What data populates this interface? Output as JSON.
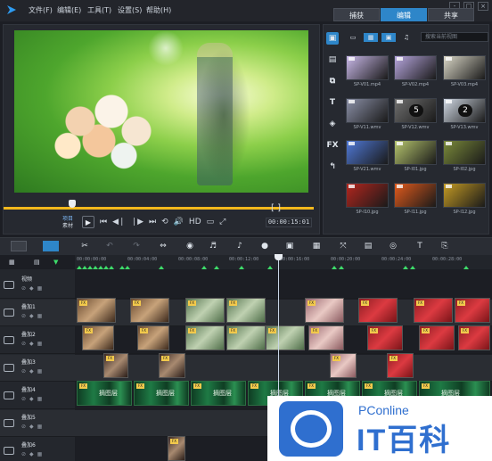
{
  "menubar": {
    "items": [
      "文件(F)",
      "编辑(E)",
      "工具(T)",
      "设置(S)",
      "帮助(H)"
    ],
    "steps": [
      "捕获",
      "编辑",
      "共享"
    ],
    "active_step": "编辑",
    "win_controls": [
      "-",
      "□",
      "×"
    ]
  },
  "preview": {
    "mode_project": "项目",
    "mode_clip": "素材",
    "hd_label": "HD",
    "trim_marks": "[ ]",
    "timecode": "00:00:15:01",
    "scrub_fraction": 0.22
  },
  "library": {
    "search_placeholder": "搜索当前视图",
    "side_labels": [
      "T",
      "FX"
    ],
    "thumbnails": [
      {
        "caption": "SP-V01.mp4",
        "color": "#c9b8e8"
      },
      {
        "caption": "SP-V02.mp4",
        "color": "#b7a6de"
      },
      {
        "caption": "SP-V03.mp4",
        "color": "#d9d6c6"
      },
      {
        "caption": "SP-V11.wmv",
        "color": "#8a8fa6"
      },
      {
        "caption": "SP-V12.wmv",
        "color": "#6f6f6f"
      },
      {
        "caption": "SP-V13.wmv",
        "color": "#cfd7e2"
      },
      {
        "caption": "SP-V21.wmv",
        "color": "#4f78d6"
      },
      {
        "caption": "SP-I01.jpg",
        "color": "#b6c56d"
      },
      {
        "caption": "SP-I02.jpg",
        "color": "#7a8a3a"
      },
      {
        "caption": "SP-I10.jpg",
        "color": "#b3261e"
      },
      {
        "caption": "SP-I11.jpg",
        "color": "#e05a1c"
      },
      {
        "caption": "SP-I12.jpg",
        "color": "#c39a24"
      }
    ],
    "badges": [
      "5",
      "2"
    ]
  },
  "timeline": {
    "header_label": "▼",
    "ruler_ticks": [
      "00:00:00:00",
      "00:00:04:00",
      "00:00:08:00",
      "00:00:12:00",
      "00:00:16:00",
      "00:00:20:00",
      "00:00:24:00",
      "00:00:28:00"
    ],
    "tracks": [
      {
        "name": "视频"
      },
      {
        "name": "叠加1"
      },
      {
        "name": "叠加2"
      },
      {
        "name": "叠加3"
      },
      {
        "name": "叠加4"
      },
      {
        "name": "叠加5"
      },
      {
        "name": "叠加6"
      }
    ],
    "clip_text": "摘图层"
  },
  "watermark": {
    "brand": "PConline",
    "brand_cn": "IT百科"
  }
}
